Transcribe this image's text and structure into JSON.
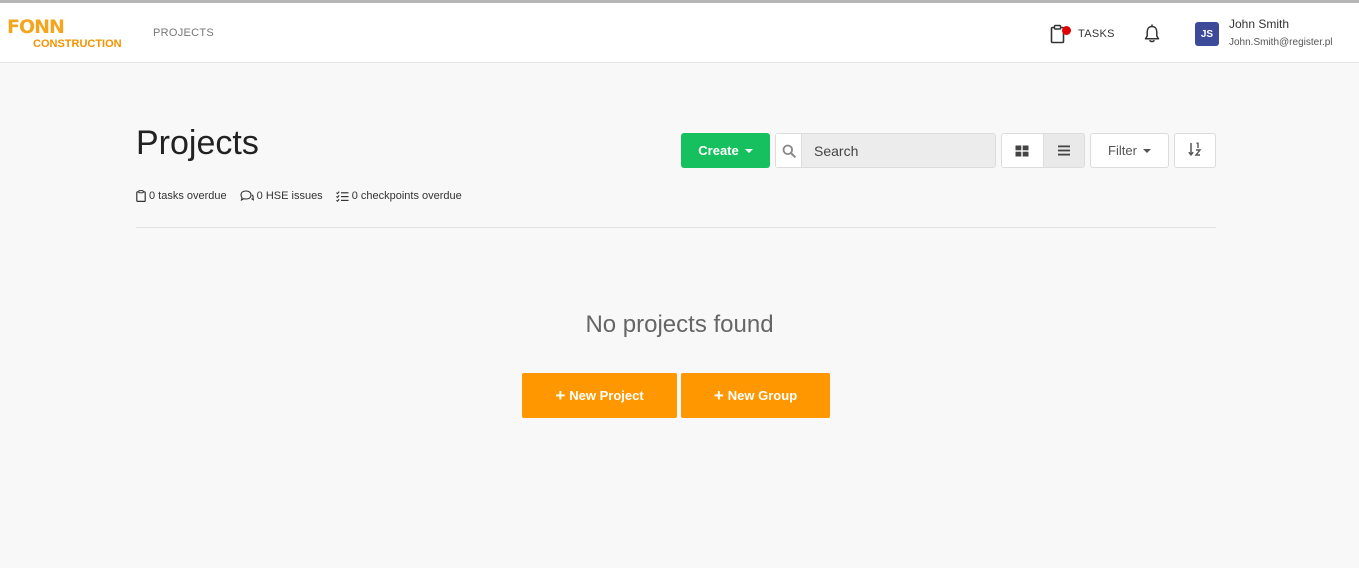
{
  "brand": {
    "logo_top": "FONN",
    "logo_bottom": "CONSTRUCTION",
    "accent": "#f39200"
  },
  "nav": {
    "projects": "PROJECTS"
  },
  "header": {
    "tasks_label": "TASKS",
    "user": {
      "initials": "JS",
      "name": "John Smith",
      "email": "John.Smith@register.pl"
    }
  },
  "page": {
    "title": "Projects"
  },
  "toolbar": {
    "create_label": "Create",
    "search_placeholder": "Search",
    "filter_label": "Filter"
  },
  "stats": {
    "tasks_overdue": "0 tasks overdue",
    "hse_issues": "0 HSE issues",
    "checkpoints_overdue": "0 checkpoints overdue"
  },
  "empty_state": {
    "message": "No projects found",
    "new_project": "New Project",
    "new_group": "New Group"
  },
  "icons": [
    "clipboard-icon",
    "bell-icon",
    "search-icon",
    "grid-view-icon",
    "list-view-icon",
    "sort-icon",
    "comments-icon",
    "checklist-icon",
    "plus-icon"
  ],
  "colors": {
    "create": "#16c05e",
    "action": "#ff9800",
    "avatar": "#3d4a9a",
    "notification": "#e00000"
  }
}
